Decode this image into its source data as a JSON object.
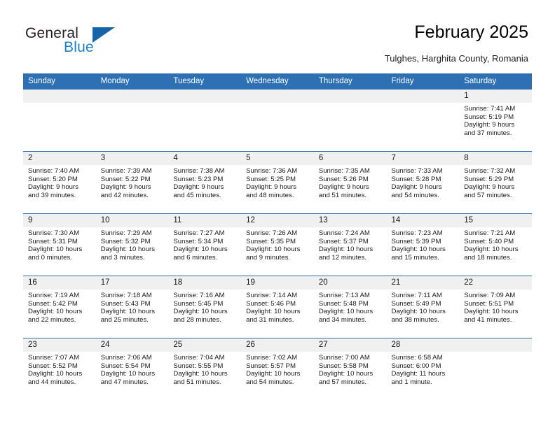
{
  "brand": {
    "name_part1": "General",
    "name_part2": "Blue",
    "triangle_color": "#1763a8",
    "blue_text_color": "#1f7fc4"
  },
  "header": {
    "title": "February 2025",
    "subtitle": "Tulghes, Harghita County, Romania"
  },
  "theme": {
    "header_blue": "#2e70b4",
    "daynum_band": "#f0f0f0",
    "cell_background": "#ffffff"
  },
  "weekday_headers": [
    "Sunday",
    "Monday",
    "Tuesday",
    "Wednesday",
    "Thursday",
    "Friday",
    "Saturday"
  ],
  "labels": {
    "sunrise_prefix": "Sunrise:",
    "sunset_prefix": "Sunset:",
    "daylight_prefix": "Daylight:"
  },
  "weeks": [
    [
      {
        "day": "",
        "sunrise": "",
        "sunset": "",
        "daylight_line1": "",
        "daylight_line2": ""
      },
      {
        "day": "",
        "sunrise": "",
        "sunset": "",
        "daylight_line1": "",
        "daylight_line2": ""
      },
      {
        "day": "",
        "sunrise": "",
        "sunset": "",
        "daylight_line1": "",
        "daylight_line2": ""
      },
      {
        "day": "",
        "sunrise": "",
        "sunset": "",
        "daylight_line1": "",
        "daylight_line2": ""
      },
      {
        "day": "",
        "sunrise": "",
        "sunset": "",
        "daylight_line1": "",
        "daylight_line2": ""
      },
      {
        "day": "",
        "sunrise": "",
        "sunset": "",
        "daylight_line1": "",
        "daylight_line2": ""
      },
      {
        "day": "1",
        "sunrise": "Sunrise: 7:41 AM",
        "sunset": "Sunset: 5:19 PM",
        "daylight_line1": "Daylight: 9 hours",
        "daylight_line2": "and 37 minutes."
      }
    ],
    [
      {
        "day": "2",
        "sunrise": "Sunrise: 7:40 AM",
        "sunset": "Sunset: 5:20 PM",
        "daylight_line1": "Daylight: 9 hours",
        "daylight_line2": "and 39 minutes."
      },
      {
        "day": "3",
        "sunrise": "Sunrise: 7:39 AM",
        "sunset": "Sunset: 5:22 PM",
        "daylight_line1": "Daylight: 9 hours",
        "daylight_line2": "and 42 minutes."
      },
      {
        "day": "4",
        "sunrise": "Sunrise: 7:38 AM",
        "sunset": "Sunset: 5:23 PM",
        "daylight_line1": "Daylight: 9 hours",
        "daylight_line2": "and 45 minutes."
      },
      {
        "day": "5",
        "sunrise": "Sunrise: 7:36 AM",
        "sunset": "Sunset: 5:25 PM",
        "daylight_line1": "Daylight: 9 hours",
        "daylight_line2": "and 48 minutes."
      },
      {
        "day": "6",
        "sunrise": "Sunrise: 7:35 AM",
        "sunset": "Sunset: 5:26 PM",
        "daylight_line1": "Daylight: 9 hours",
        "daylight_line2": "and 51 minutes."
      },
      {
        "day": "7",
        "sunrise": "Sunrise: 7:33 AM",
        "sunset": "Sunset: 5:28 PM",
        "daylight_line1": "Daylight: 9 hours",
        "daylight_line2": "and 54 minutes."
      },
      {
        "day": "8",
        "sunrise": "Sunrise: 7:32 AM",
        "sunset": "Sunset: 5:29 PM",
        "daylight_line1": "Daylight: 9 hours",
        "daylight_line2": "and 57 minutes."
      }
    ],
    [
      {
        "day": "9",
        "sunrise": "Sunrise: 7:30 AM",
        "sunset": "Sunset: 5:31 PM",
        "daylight_line1": "Daylight: 10 hours",
        "daylight_line2": "and 0 minutes."
      },
      {
        "day": "10",
        "sunrise": "Sunrise: 7:29 AM",
        "sunset": "Sunset: 5:32 PM",
        "daylight_line1": "Daylight: 10 hours",
        "daylight_line2": "and 3 minutes."
      },
      {
        "day": "11",
        "sunrise": "Sunrise: 7:27 AM",
        "sunset": "Sunset: 5:34 PM",
        "daylight_line1": "Daylight: 10 hours",
        "daylight_line2": "and 6 minutes."
      },
      {
        "day": "12",
        "sunrise": "Sunrise: 7:26 AM",
        "sunset": "Sunset: 5:35 PM",
        "daylight_line1": "Daylight: 10 hours",
        "daylight_line2": "and 9 minutes."
      },
      {
        "day": "13",
        "sunrise": "Sunrise: 7:24 AM",
        "sunset": "Sunset: 5:37 PM",
        "daylight_line1": "Daylight: 10 hours",
        "daylight_line2": "and 12 minutes."
      },
      {
        "day": "14",
        "sunrise": "Sunrise: 7:23 AM",
        "sunset": "Sunset: 5:39 PM",
        "daylight_line1": "Daylight: 10 hours",
        "daylight_line2": "and 15 minutes."
      },
      {
        "day": "15",
        "sunrise": "Sunrise: 7:21 AM",
        "sunset": "Sunset: 5:40 PM",
        "daylight_line1": "Daylight: 10 hours",
        "daylight_line2": "and 18 minutes."
      }
    ],
    [
      {
        "day": "16",
        "sunrise": "Sunrise: 7:19 AM",
        "sunset": "Sunset: 5:42 PM",
        "daylight_line1": "Daylight: 10 hours",
        "daylight_line2": "and 22 minutes."
      },
      {
        "day": "17",
        "sunrise": "Sunrise: 7:18 AM",
        "sunset": "Sunset: 5:43 PM",
        "daylight_line1": "Daylight: 10 hours",
        "daylight_line2": "and 25 minutes."
      },
      {
        "day": "18",
        "sunrise": "Sunrise: 7:16 AM",
        "sunset": "Sunset: 5:45 PM",
        "daylight_line1": "Daylight: 10 hours",
        "daylight_line2": "and 28 minutes."
      },
      {
        "day": "19",
        "sunrise": "Sunrise: 7:14 AM",
        "sunset": "Sunset: 5:46 PM",
        "daylight_line1": "Daylight: 10 hours",
        "daylight_line2": "and 31 minutes."
      },
      {
        "day": "20",
        "sunrise": "Sunrise: 7:13 AM",
        "sunset": "Sunset: 5:48 PM",
        "daylight_line1": "Daylight: 10 hours",
        "daylight_line2": "and 34 minutes."
      },
      {
        "day": "21",
        "sunrise": "Sunrise: 7:11 AM",
        "sunset": "Sunset: 5:49 PM",
        "daylight_line1": "Daylight: 10 hours",
        "daylight_line2": "and 38 minutes."
      },
      {
        "day": "22",
        "sunrise": "Sunrise: 7:09 AM",
        "sunset": "Sunset: 5:51 PM",
        "daylight_line1": "Daylight: 10 hours",
        "daylight_line2": "and 41 minutes."
      }
    ],
    [
      {
        "day": "23",
        "sunrise": "Sunrise: 7:07 AM",
        "sunset": "Sunset: 5:52 PM",
        "daylight_line1": "Daylight: 10 hours",
        "daylight_line2": "and 44 minutes."
      },
      {
        "day": "24",
        "sunrise": "Sunrise: 7:06 AM",
        "sunset": "Sunset: 5:54 PM",
        "daylight_line1": "Daylight: 10 hours",
        "daylight_line2": "and 47 minutes."
      },
      {
        "day": "25",
        "sunrise": "Sunrise: 7:04 AM",
        "sunset": "Sunset: 5:55 PM",
        "daylight_line1": "Daylight: 10 hours",
        "daylight_line2": "and 51 minutes."
      },
      {
        "day": "26",
        "sunrise": "Sunrise: 7:02 AM",
        "sunset": "Sunset: 5:57 PM",
        "daylight_line1": "Daylight: 10 hours",
        "daylight_line2": "and 54 minutes."
      },
      {
        "day": "27",
        "sunrise": "Sunrise: 7:00 AM",
        "sunset": "Sunset: 5:58 PM",
        "daylight_line1": "Daylight: 10 hours",
        "daylight_line2": "and 57 minutes."
      },
      {
        "day": "28",
        "sunrise": "Sunrise: 6:58 AM",
        "sunset": "Sunset: 6:00 PM",
        "daylight_line1": "Daylight: 11 hours",
        "daylight_line2": "and 1 minute."
      },
      {
        "day": "",
        "sunrise": "",
        "sunset": "",
        "daylight_line1": "",
        "daylight_line2": ""
      }
    ]
  ]
}
